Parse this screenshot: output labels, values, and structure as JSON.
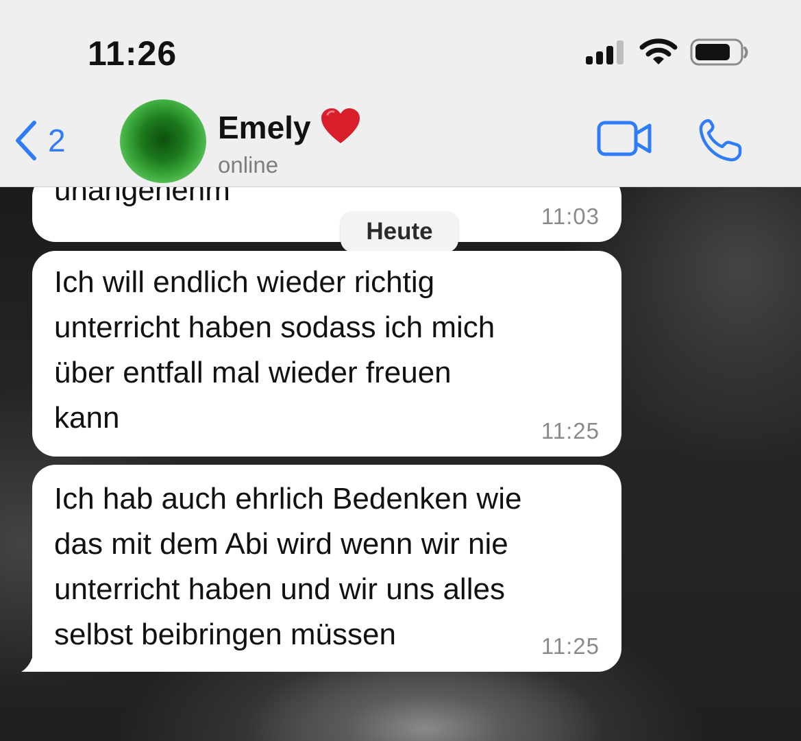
{
  "status_bar": {
    "time": "11:26",
    "signal_icon": "cellular-signal-icon",
    "wifi_icon": "wifi-icon",
    "battery_icon": "battery-icon"
  },
  "header": {
    "back_count": "2",
    "back_icon": "chevron-left-icon",
    "contact_name": "Emely",
    "contact_emoji": "red-heart-icon",
    "contact_status": "online",
    "video_call_icon": "video-camera-icon",
    "voice_call_icon": "phone-icon",
    "accent_color": "#2f7cf6"
  },
  "chat": {
    "date_separator": "Heute",
    "messages": [
      {
        "text": "unangenehm",
        "time": "11:03"
      },
      {
        "text": "Ich will endlich wieder richtig\nunterricht haben sodass ich mich\nüber entfall mal wieder freuen\nkann",
        "time": "11:25"
      },
      {
        "text": "Ich hab auch ehrlich Bedenken wie\ndas mit dem Abi wird wenn wir nie\nunterricht haben und wir uns alles\nselbst beibringen müssen",
        "time": "11:25"
      }
    ]
  }
}
